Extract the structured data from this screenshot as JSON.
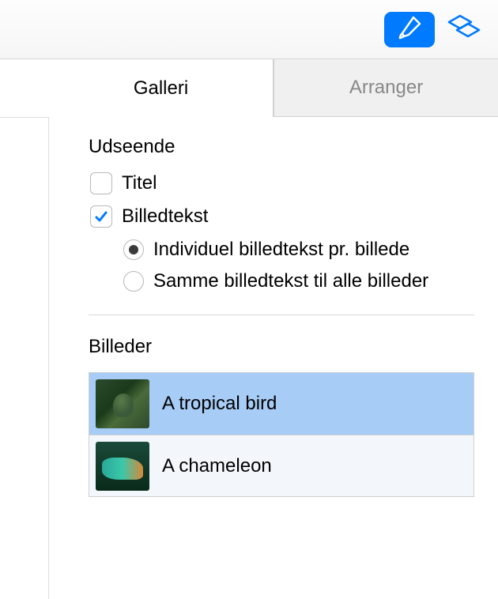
{
  "toolbar": {
    "format_icon": "paintbrush-icon",
    "organize_icon": "shapes-icon"
  },
  "tabs": {
    "gallery": "Galleri",
    "arrange": "Arranger"
  },
  "appearance": {
    "title": "Udseende",
    "title_checkbox": {
      "label": "Titel",
      "checked": false
    },
    "caption_checkbox": {
      "label": "Billedtekst",
      "checked": true
    },
    "caption_options": {
      "individual": "Individuel billedtekst pr. billede",
      "same": "Samme billedtekst til alle billeder",
      "selected": "individual"
    }
  },
  "images": {
    "title": "Billeder",
    "items": [
      {
        "caption": "A tropical bird",
        "selected": true,
        "thumb": "bird"
      },
      {
        "caption": "A chameleon",
        "selected": false,
        "thumb": "chameleon"
      }
    ]
  }
}
